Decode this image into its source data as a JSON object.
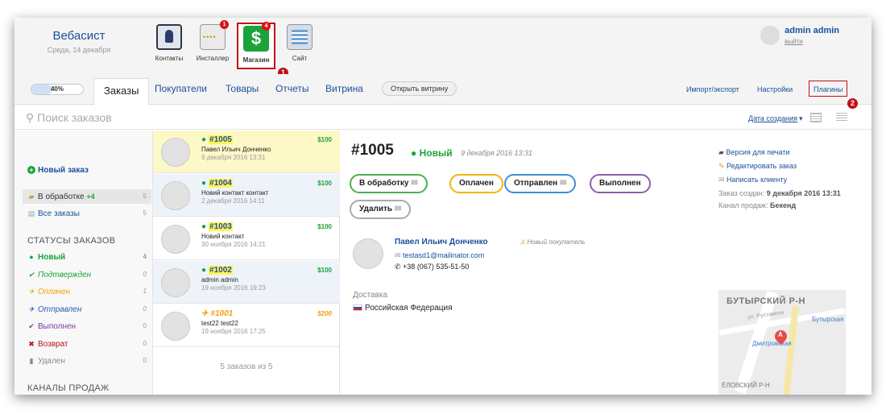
{
  "brand": {
    "name": "Вебасист",
    "date": "Среда, 14 декабря"
  },
  "apps": [
    {
      "label": "Контакты",
      "icon": "contacts-icon",
      "badge": ""
    },
    {
      "label": "Инсталлер",
      "icon": "installer-icon",
      "badge": "1"
    },
    {
      "label": "Магазин",
      "icon": "shop-icon",
      "badge": "4",
      "glyph": "$"
    },
    {
      "label": "Сайт",
      "icon": "site-icon",
      "badge": ""
    }
  ],
  "user": {
    "name": "admin admin",
    "logout": "выйти"
  },
  "callouts": {
    "one": "1",
    "two": "2"
  },
  "progress": {
    "label": "40%",
    "value": 0.4
  },
  "tabs": {
    "orders": "Заказы",
    "customers": "Покупатели",
    "products": "Товары",
    "reports": "Отчеты",
    "storefront": "Витрина",
    "open_storefront": "Открыть витрину",
    "import_export": "Импорт/экспорт",
    "settings": "Настройки",
    "plugins": "Плагины"
  },
  "search": {
    "placeholder": "Поиск заказов",
    "sort_label": "Дата создания",
    "sort_arrow": "▾"
  },
  "sidebar": {
    "new_order": "Новый заказ",
    "processing": {
      "label": "В обработке",
      "badge": "+4",
      "count": "5"
    },
    "all_orders": {
      "label": "Все заказы",
      "count": "5"
    },
    "statuses_title": "СТАТУСЫ ЗАКАЗОВ",
    "statuses": [
      {
        "label": "Новый",
        "count": "4",
        "color": "#19a33a",
        "icon": "●"
      },
      {
        "label": "Подтвержден",
        "count": "0",
        "color": "#19a33a",
        "icon": "✔"
      },
      {
        "label": "Оплачен",
        "count": "1",
        "color": "#f29e0c",
        "icon": "✈"
      },
      {
        "label": "Отправлен",
        "count": "0",
        "color": "#2b56b8",
        "icon": "✈"
      },
      {
        "label": "Выполнен",
        "count": "0",
        "color": "#7c3b9c",
        "icon": "✔"
      },
      {
        "label": "Возврат",
        "count": "0",
        "color": "#c0101a",
        "icon": "✖"
      },
      {
        "label": "Удален",
        "count": "0",
        "color": "#888888",
        "icon": "▮"
      }
    ],
    "channels_title": "КАНАЛЫ ПРОДАЖ"
  },
  "orders": [
    {
      "number": "#1005",
      "name": "Павел Ильич Донченко",
      "date": "9 декабря 2016 13:31",
      "sum": "$100"
    },
    {
      "number": "#1004",
      "name": "Новий контакт контакт",
      "date": "2 декабря 2016 14:11",
      "sum": "$100"
    },
    {
      "number": "#1003",
      "name": "Новий контакт",
      "date": "30 ноября 2016 14:21",
      "sum": "$100"
    },
    {
      "number": "#1002",
      "name": "admin admin",
      "date": "19 ноября 2016 19:23",
      "sum": "$100"
    },
    {
      "number": "#1001",
      "name": "test22 test22",
      "date": "19 ноября 2016 17:25",
      "sum": "$200"
    }
  ],
  "list_count": "5 заказов из 5",
  "detail": {
    "title": "#1005",
    "status": "Новый",
    "date": "9 декабря 2016 13:31",
    "actions": {
      "processing": "В обработку",
      "paid": "Оплачен",
      "shipped": "Отправлен",
      "completed": "Выполнен",
      "delete": "Удалить"
    },
    "links": {
      "print": "Версия для печати",
      "edit": "Редактировать заказ",
      "write": "Написать клиенту"
    },
    "meta": {
      "created_label": "Заказ создан:",
      "created_value": "9 декабря 2016 13:31",
      "channel_label": "Канал продаж:",
      "channel_value": "Бекенд"
    },
    "customer": {
      "name": "Павел Ильич Донченко",
      "tag": "Новый покупатель",
      "email": "testasd1@mailinator.com",
      "phone": "+38 (067) 535-51-50"
    },
    "delivery_label": "Доставка",
    "country": "Российская Федерация"
  },
  "map": {
    "district": "БУТЫРСКИЙ Р-Н",
    "street": "ул. Руставели",
    "metro1": "Бутырская",
    "metro2": "Дмитровская",
    "pin": "A",
    "bottom": "ЁЛОВСКИЙ Р-Н"
  }
}
